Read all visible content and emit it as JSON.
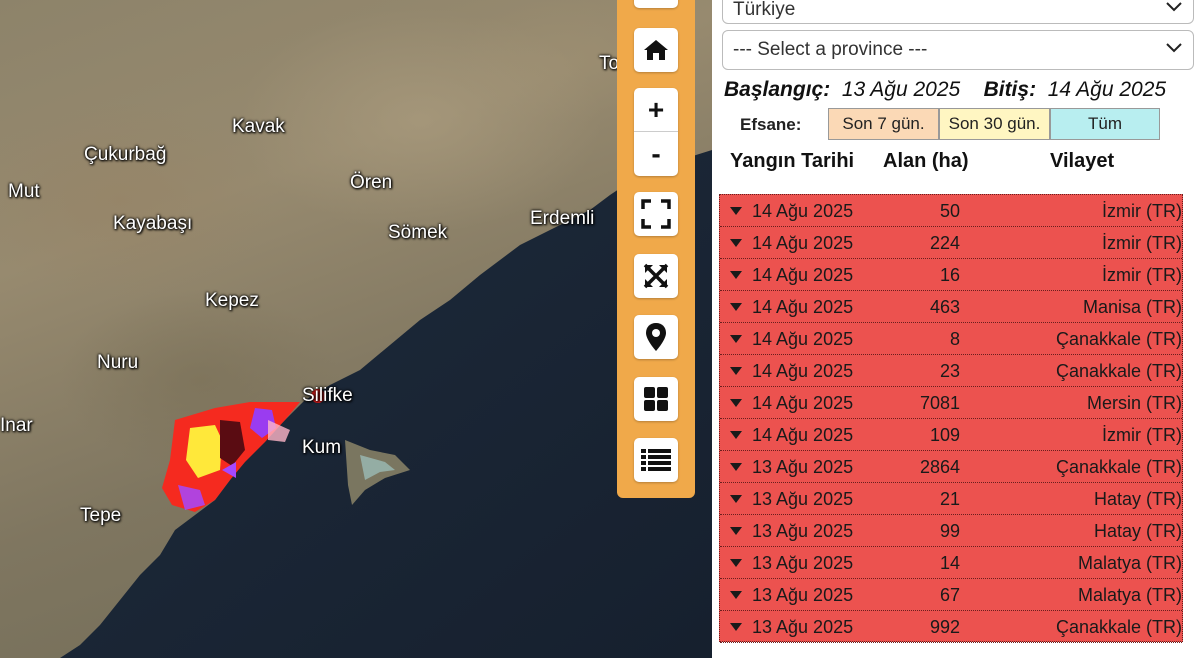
{
  "map": {
    "places": [
      {
        "name": "Kavak",
        "id": "kavak"
      },
      {
        "name": "Çukurbağ",
        "id": "cukurbag"
      },
      {
        "name": "Mut",
        "id": "mut"
      },
      {
        "name": "Ören",
        "id": "oren"
      },
      {
        "name": "Kayabaşı",
        "id": "kayabasi"
      },
      {
        "name": "Sömek",
        "id": "somek"
      },
      {
        "name": "Erdemli",
        "id": "erdemli"
      },
      {
        "name": "Kepez",
        "id": "kepez"
      },
      {
        "name": "Nuru",
        "id": "nuru"
      },
      {
        "name": "Silifke",
        "id": "silifke"
      },
      {
        "name": "Inar",
        "id": "inar"
      },
      {
        "name": "Kum",
        "id": "kum"
      },
      {
        "name": "Tepe",
        "id": "tepe"
      },
      {
        "name": "To",
        "id": "to"
      }
    ]
  },
  "toolbar": {
    "buttons": [
      "home-icon",
      "zoom-in-icon",
      "zoom-out-icon",
      "fullscreen-icon",
      "expand-icon",
      "location-pin-icon",
      "grid-icon",
      "list-icon"
    ],
    "zoom_in_label": "+",
    "zoom_out_label": "-"
  },
  "panel": {
    "country_select": "Türkiye",
    "province_select": "--- Select a province ---",
    "start_label": "Başlangıç:",
    "start_value": "13 Ağu 2025",
    "end_label": "Bitiş:",
    "end_value": "14 Ağu 2025",
    "legend_label": "Efsane:",
    "legend": [
      {
        "label": "Son 7 gün.",
        "color": "#fbd9b6"
      },
      {
        "label": "Son 30 gün.",
        "color": "#fff6c2"
      },
      {
        "label": "Tüm",
        "color": "#b8eef0"
      }
    ],
    "headers": {
      "date": "Yangın Tarihi",
      "area": "Alan (ha)",
      "province": "Vilayet"
    },
    "row_color": "#ec524f",
    "rows": [
      {
        "date": "14 Ağu 2025",
        "area": "50",
        "province": "İzmir (TR)"
      },
      {
        "date": "14 Ağu 2025",
        "area": "224",
        "province": "İzmir (TR)"
      },
      {
        "date": "14 Ağu 2025",
        "area": "16",
        "province": "İzmir (TR)"
      },
      {
        "date": "14 Ağu 2025",
        "area": "463",
        "province": "Manisa (TR)"
      },
      {
        "date": "14 Ağu 2025",
        "area": "8",
        "province": "Çanakkale (TR)"
      },
      {
        "date": "14 Ağu 2025",
        "area": "23",
        "province": "Çanakkale (TR)"
      },
      {
        "date": "14 Ağu 2025",
        "area": "7081",
        "province": "Mersin (TR)"
      },
      {
        "date": "14 Ağu 2025",
        "area": "109",
        "province": "İzmir (TR)"
      },
      {
        "date": "13 Ağu 2025",
        "area": "2864",
        "province": "Çanakkale (TR)"
      },
      {
        "date": "13 Ağu 2025",
        "area": "21",
        "province": "Hatay (TR)"
      },
      {
        "date": "13 Ağu 2025",
        "area": "99",
        "province": "Hatay (TR)"
      },
      {
        "date": "13 Ağu 2025",
        "area": "14",
        "province": "Malatya (TR)"
      },
      {
        "date": "13 Ağu 2025",
        "area": "67",
        "province": "Malatya (TR)"
      },
      {
        "date": "13 Ağu 2025",
        "area": "992",
        "province": "Çanakkale (TR)"
      }
    ]
  }
}
